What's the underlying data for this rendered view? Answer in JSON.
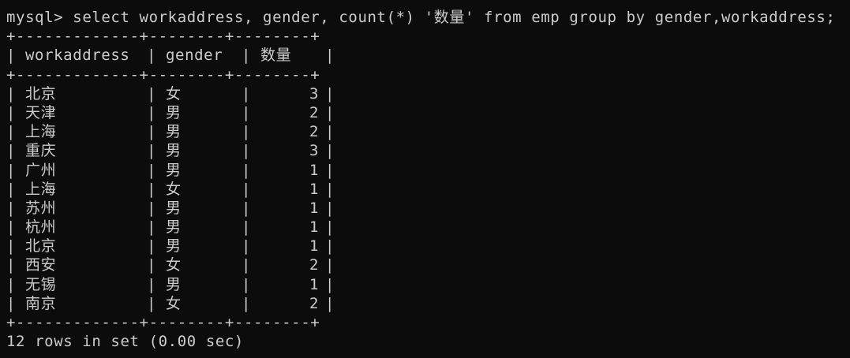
{
  "prompt": "mysql>",
  "command": "select workaddress, gender, count(*) '数量' from emp group by gender,workaddress;",
  "border": "+-------------+--------+--------+",
  "headers": [
    "workaddress",
    "gender",
    "数量"
  ],
  "rows": [
    [
      "北京",
      "女",
      "3"
    ],
    [
      "天津",
      "男",
      "2"
    ],
    [
      "上海",
      "男",
      "2"
    ],
    [
      "重庆",
      "男",
      "3"
    ],
    [
      "广州",
      "男",
      "1"
    ],
    [
      "上海",
      "女",
      "1"
    ],
    [
      "苏州",
      "男",
      "1"
    ],
    [
      "杭州",
      "男",
      "1"
    ],
    [
      "北京",
      "男",
      "1"
    ],
    [
      "西安",
      "女",
      "2"
    ],
    [
      "无锡",
      "男",
      "1"
    ],
    [
      "南京",
      "女",
      "2"
    ]
  ],
  "footer": "12 rows in set (0.00 sec)"
}
